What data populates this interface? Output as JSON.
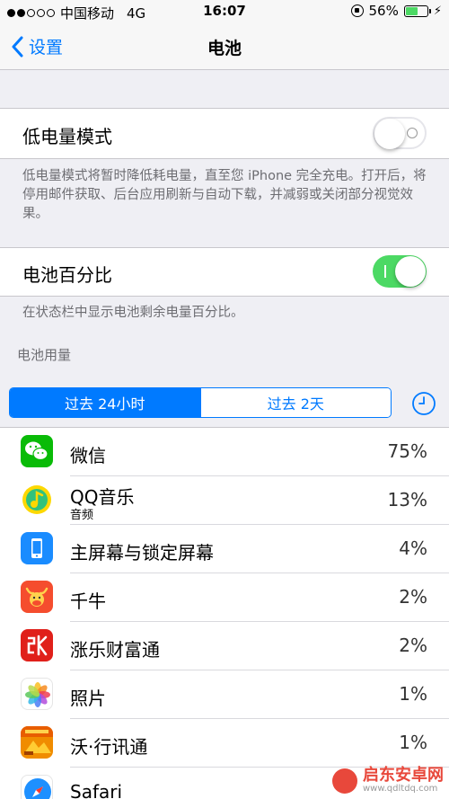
{
  "status_bar": {
    "carrier": "中国移动",
    "network": "4G",
    "time": "16:07",
    "battery_percent": "56%",
    "battery_level": 0.56
  },
  "nav": {
    "back_label": "设置",
    "title": "电池"
  },
  "low_power": {
    "label": "低电量模式",
    "enabled": false,
    "footnote": "低电量模式将暂时降低耗电量，直至您 iPhone 完全充电。打开后，将停用邮件获取、后台应用刷新与自动下载，并减弱或关闭部分视觉效果。"
  },
  "battery_percentage": {
    "label": "电池百分比",
    "enabled": true,
    "footnote": "在状态栏中显示电池剩余电量百分比。"
  },
  "usage": {
    "section_header": "电池用量",
    "segments": [
      "过去 24小时",
      "过去 2天"
    ],
    "selected_segment": 0,
    "apps": [
      {
        "name": "微信",
        "sub": "",
        "percent": "75%",
        "icon": "wechat-icon",
        "color": "#09bb07"
      },
      {
        "name": "QQ音乐",
        "sub": "音频",
        "percent": "13%",
        "icon": "qq-music-icon",
        "color": "#31c27c"
      },
      {
        "name": "主屏幕与锁定屏幕",
        "sub": "",
        "percent": "4%",
        "icon": "home-lock-screen-icon",
        "color": "#1a8cff"
      },
      {
        "name": "千牛",
        "sub": "",
        "percent": "2%",
        "icon": "qianniu-icon",
        "color": "#f54d2e"
      },
      {
        "name": "涨乐财富通",
        "sub": "",
        "percent": "2%",
        "icon": "zhangle-icon",
        "color": "#e0201a"
      },
      {
        "name": "照片",
        "sub": "",
        "percent": "1%",
        "icon": "photos-icon",
        "color": "#ffffff"
      },
      {
        "name": "沃·行讯通",
        "sub": "",
        "percent": "1%",
        "icon": "wo-xingxuntong-icon",
        "color": "#f08c00"
      },
      {
        "name": "Safari",
        "sub": "",
        "percent": "",
        "icon": "safari-icon",
        "color": "#1e90ff"
      }
    ]
  },
  "watermark": {
    "text": "启东安卓网",
    "url": "www.qdltdq.com"
  }
}
